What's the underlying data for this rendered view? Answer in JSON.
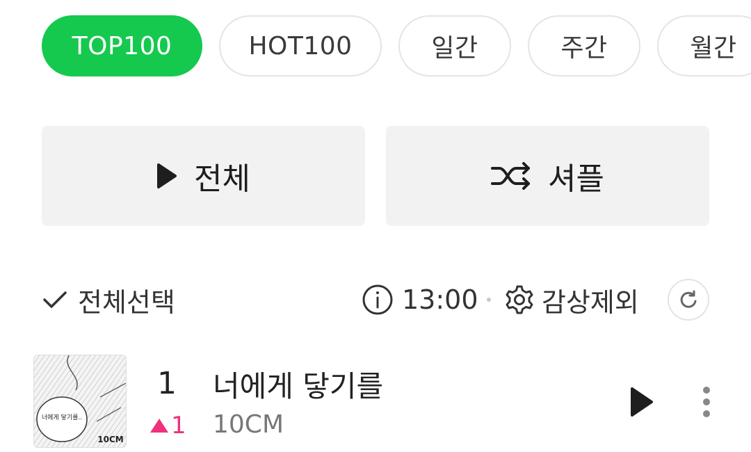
{
  "tabs": [
    {
      "label": "TOP100",
      "active": true
    },
    {
      "label": "HOT100",
      "active": false
    },
    {
      "label": "일간",
      "active": false
    },
    {
      "label": "주간",
      "active": false
    },
    {
      "label": "월간",
      "active": false
    }
  ],
  "actions": {
    "play_all_label": "전체",
    "play_icon": "play-icon",
    "shuffle_label": "셔플",
    "shuffle_icon": "shuffle-icon"
  },
  "options": {
    "select_all_label": "전체선택",
    "update_time": "13:00",
    "exclude_label": "감상제외",
    "icons": [
      "check-icon",
      "info-icon",
      "gear-icon",
      "refresh-icon"
    ]
  },
  "songs": [
    {
      "rank": "1",
      "change": "1",
      "change_direction": "up",
      "title": "너에게 닿기를",
      "artist": "10CM",
      "album_art": {
        "bubble_text": "너에게 닿기를..",
        "logo_text": "10CM"
      }
    }
  ],
  "colors": {
    "accent": "#15c94e",
    "rank_up": "#f0307a",
    "button_bg": "#f2f2f2"
  }
}
